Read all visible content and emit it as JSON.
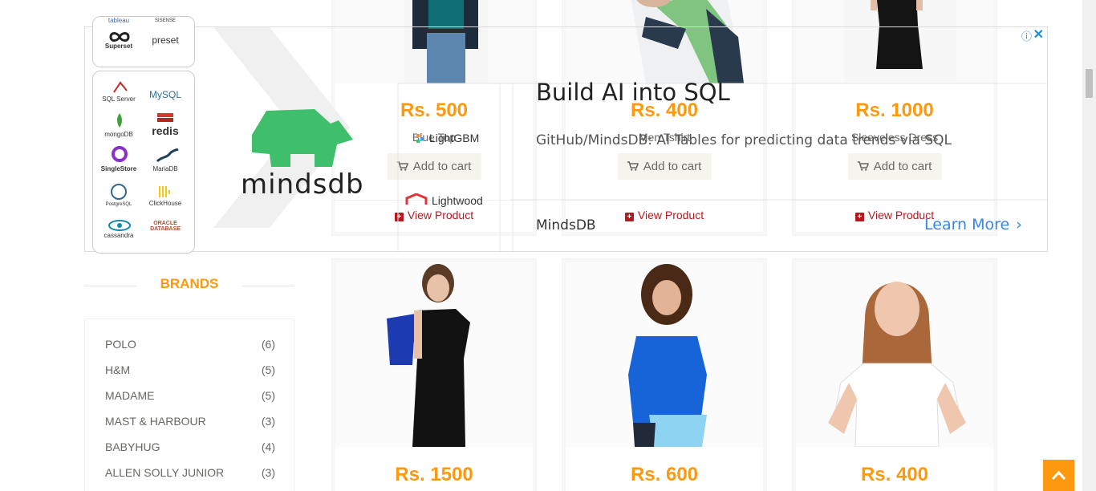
{
  "products_top": [
    {
      "price": "Rs. 500",
      "name": "Blue Top",
      "add_label": "Add to cart",
      "view_label": "View Product"
    },
    {
      "price": "Rs. 400",
      "name": "Men Tshirt",
      "add_label": "Add to cart",
      "view_label": "View Product"
    },
    {
      "price": "Rs. 1000",
      "name": "Sleeveless Dress",
      "add_label": "Add to cart",
      "view_label": "View Product"
    }
  ],
  "products_bottom": [
    {
      "price": "Rs. 1500"
    },
    {
      "price": "Rs. 600"
    },
    {
      "price": "Rs. 400"
    }
  ],
  "ad": {
    "headline": "Build AI into SQL",
    "text": "GitHub/MindsDB: AI Tables for predicting data trends via SQL",
    "brand": "MindsDB",
    "cta": "Learn More",
    "logo_text": "mindsdb",
    "db_logos": [
      "tableau",
      "SISENSE",
      "Superset",
      "preset",
      "SQL Server",
      "MySQL",
      "mongoDB",
      "redis",
      "SingleStore",
      "MariaDB",
      "PostgreSQL",
      "ClickHouse",
      "cassandra",
      "ORACLE DATABASE"
    ],
    "ml_logos": [
      "LightGBM",
      "Lightwood"
    ],
    "accent": "#3a84e6",
    "logo_color": "#3fbf6b"
  },
  "sidebar": {
    "brands_title": "BRANDS",
    "brands": [
      {
        "name": "POLO",
        "count": "(6)"
      },
      {
        "name": "H&M",
        "count": "(5)"
      },
      {
        "name": "MADAME",
        "count": "(5)"
      },
      {
        "name": "MAST & HARBOUR",
        "count": "(3)"
      },
      {
        "name": "BABYHUG",
        "count": "(4)"
      },
      {
        "name": "ALLEN SOLLY JUNIOR",
        "count": "(3)"
      }
    ]
  },
  "colors": {
    "price": "#FE980F",
    "view": "#B3191F",
    "button_bg": "#F5F5ED"
  }
}
